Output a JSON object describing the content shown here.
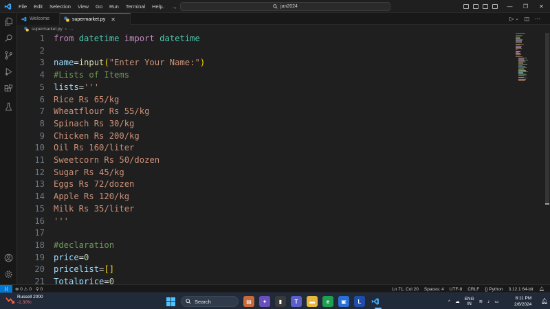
{
  "titlebar": {
    "menu": [
      "File",
      "Edit",
      "Selection",
      "View",
      "Go",
      "Run",
      "Terminal",
      "Help"
    ],
    "search_text": "jan2024"
  },
  "tabs": [
    {
      "label": "Welcome",
      "active": false
    },
    {
      "label": "supermarket.py",
      "active": true,
      "close": "✕"
    }
  ],
  "breadcrumb": {
    "file": "supermarket.py",
    "more": "..."
  },
  "editor": {
    "lines": [
      {
        "n": "1",
        "tokens": [
          {
            "t": "from",
            "c": "kw"
          },
          {
            "t": " ",
            "c": "op"
          },
          {
            "t": "datetime",
            "c": "cls"
          },
          {
            "t": " ",
            "c": "op"
          },
          {
            "t": "import",
            "c": "kw"
          },
          {
            "t": " ",
            "c": "op"
          },
          {
            "t": "datetime",
            "c": "cls"
          }
        ]
      },
      {
        "n": "2",
        "tokens": []
      },
      {
        "n": "3",
        "tokens": [
          {
            "t": "name",
            "c": "var"
          },
          {
            "t": "=",
            "c": "op"
          },
          {
            "t": "input",
            "c": "fn"
          },
          {
            "t": "(",
            "c": "br"
          },
          {
            "t": "\"Enter Your Name:\"",
            "c": "str"
          },
          {
            "t": ")",
            "c": "br"
          }
        ]
      },
      {
        "n": "4",
        "tokens": [
          {
            "t": "#Lists of Items",
            "c": "cmt"
          }
        ]
      },
      {
        "n": "5",
        "tokens": [
          {
            "t": "lists",
            "c": "var"
          },
          {
            "t": "=",
            "c": "op"
          },
          {
            "t": "'''",
            "c": "str"
          }
        ]
      },
      {
        "n": "6",
        "tokens": [
          {
            "t": "Rice Rs 65/kg",
            "c": "str"
          }
        ]
      },
      {
        "n": "7",
        "tokens": [
          {
            "t": "Wheatflour Rs 55/kg",
            "c": "str"
          }
        ]
      },
      {
        "n": "8",
        "tokens": [
          {
            "t": "Spinach Rs 30/kg",
            "c": "str"
          }
        ]
      },
      {
        "n": "9",
        "tokens": [
          {
            "t": "Chicken Rs 200/kg",
            "c": "str"
          }
        ]
      },
      {
        "n": "10",
        "tokens": [
          {
            "t": "Oil Rs 160/liter",
            "c": "str"
          }
        ]
      },
      {
        "n": "11",
        "tokens": [
          {
            "t": "Sweetcorn Rs 50/dozen",
            "c": "str"
          }
        ]
      },
      {
        "n": "12",
        "tokens": [
          {
            "t": "Sugar Rs 45/kg",
            "c": "str"
          }
        ]
      },
      {
        "n": "13",
        "tokens": [
          {
            "t": "Eggs Rs 72/dozen",
            "c": "str"
          }
        ]
      },
      {
        "n": "14",
        "tokens": [
          {
            "t": "Apple Rs 120/kg",
            "c": "str"
          }
        ]
      },
      {
        "n": "15",
        "tokens": [
          {
            "t": "Milk Rs 35/liter",
            "c": "str"
          }
        ]
      },
      {
        "n": "16",
        "tokens": [
          {
            "t": "'''",
            "c": "str"
          }
        ]
      },
      {
        "n": "17",
        "tokens": []
      },
      {
        "n": "18",
        "tokens": [
          {
            "t": "#declaration",
            "c": "cmt"
          }
        ]
      },
      {
        "n": "19",
        "tokens": [
          {
            "t": "price",
            "c": "var"
          },
          {
            "t": "=",
            "c": "op"
          },
          {
            "t": "0",
            "c": "num"
          }
        ]
      },
      {
        "n": "20",
        "tokens": [
          {
            "t": "pricelist",
            "c": "var"
          },
          {
            "t": "=",
            "c": "op"
          },
          {
            "t": "[]",
            "c": "br"
          }
        ]
      },
      {
        "n": "21",
        "tokens": [
          {
            "t": "Totalprice",
            "c": "var"
          },
          {
            "t": "=",
            "c": "op"
          },
          {
            "t": "0",
            "c": "num"
          }
        ]
      }
    ]
  },
  "statusbar": {
    "errors": "0",
    "warnings": "0",
    "ports": "0",
    "position": "Ln 71, Col 20",
    "spaces": "Spaces: 4",
    "encoding": "UTF-8",
    "eol": "CRLF",
    "language": "Python",
    "interpreter": "3.12.1 64-bit"
  },
  "taskbar": {
    "widget_name": "Russell 2000",
    "widget_change": "-1.30%",
    "search_label": "Search",
    "lang_top": "ENG",
    "lang_bottom": "IN",
    "time": "8:11 PM",
    "date": "2/6/2024"
  },
  "colors": {
    "accent": "#0078d4",
    "keyword": "#c586c0",
    "string": "#ce9178",
    "comment": "#6a9955",
    "variable": "#9cdcfe",
    "class": "#4ec9b0",
    "function": "#dcdcaa",
    "number": "#b5cea8",
    "bracket": "#ffd700"
  }
}
